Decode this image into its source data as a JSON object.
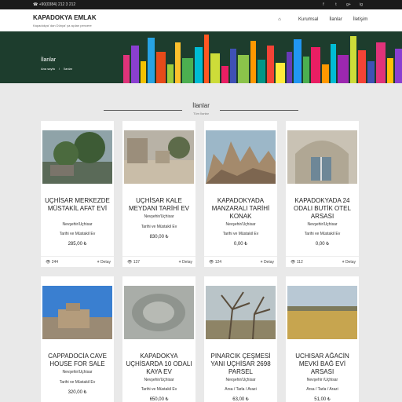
{
  "topbar": {
    "phone": "+90(0384) 212 3 212",
    "social": [
      "f",
      "t",
      "g+",
      "ig"
    ]
  },
  "navbar": {
    "brand": "KAPADOKYA EMLAK",
    "tagline": "Kapadokya' dan Dünya' ya açılan pencere",
    "home_icon": "⌂",
    "items": [
      "Kurumsal",
      "İlanlar",
      "İletişim"
    ]
  },
  "hero": {
    "title": "İlanlar",
    "breadcrumb_home": "Ana sayfa",
    "breadcrumb_sep": "/",
    "breadcrumb_current": "İlanlar"
  },
  "section": {
    "title": "İlanlar",
    "subtitle": "Tüm İlanlar"
  },
  "listings": [
    {
      "title": "UÇHİSAR MERKEZDE MÜSTAKİL AFAT EVİ",
      "location": "Nevşehir/Uçhisar",
      "type": "Tarihi ve Müstakil Ev",
      "price": "285,00 ₺",
      "views": "244",
      "detail": "Detay"
    },
    {
      "title": "UÇHİSAR KALE MEYDANI TARİHİ EV",
      "location": "Nevşehir/Uçhisar",
      "type": "Tarihi ve Müstakil Ev",
      "price": "830,00 ₺",
      "views": "137",
      "detail": "Detay"
    },
    {
      "title": "KAPADOKYADA MANZARALI TARİHİ KONAK",
      "location": "Nevşehir/Uçhisar",
      "type": "Tarihi ve Müstakil Ev",
      "price": "0,00 ₺",
      "views": "124",
      "detail": "Detay"
    },
    {
      "title": "KAPADOKYADA 24 ODALI BUTİK OTEL ARSASI",
      "location": "Nevşehir/Uçhisar",
      "type": "Tarihi ve Müstakil Ev",
      "price": "0,00 ₺",
      "views": "112",
      "detail": "Detay"
    },
    {
      "title": "CAPPADOCİA CAVE HOUSE FOR SALE",
      "location": "Nevşehir/Uçhisar",
      "type": "Tarihi ve Müstakil Ev",
      "price": "320,00 ₺",
      "views": "",
      "detail": ""
    },
    {
      "title": "KAPADOKYA UÇHİSARDA 10 ODALI KAYA EV",
      "location": "Nevşehir/Uçhisar",
      "type": "Tarihi ve Müstakil Ev",
      "price": "650,00 ₺",
      "views": "",
      "detail": ""
    },
    {
      "title": "PINARCIK ÇEŞMESİ YANI UÇHİSAR 2698 PARSEL",
      "location": "Nevşehir/Uçhisar",
      "type": "Arsa / Tarla / Arazi",
      "price": "63,00 ₺",
      "views": "",
      "detail": ""
    },
    {
      "title": "UCHISAR AĞACİN MEVKİ BAĞ EVİ ARSASI",
      "location": "Nevşehir /Uçhisar",
      "type": "Arsa / Tarla / Arazi",
      "price": "51,00 ₺",
      "views": "",
      "detail": ""
    }
  ],
  "icons": {
    "eye": "eye-icon",
    "plus": "plus-icon",
    "home": "home-icon"
  },
  "colors": {
    "hero_bg": "#1d3d2d",
    "topbar_bg": "#1b1b1b"
  }
}
